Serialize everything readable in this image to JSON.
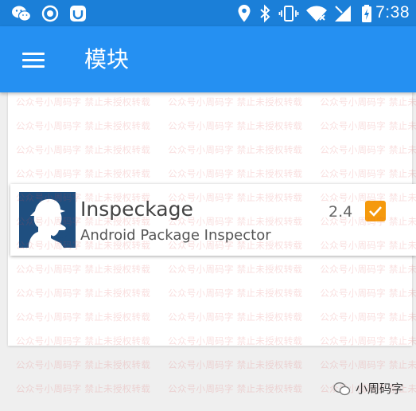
{
  "status_bar": {
    "time": "7:38",
    "icons": [
      "wechat-icon",
      "record-icon",
      "app-icon",
      "location-icon",
      "bluetooth-icon",
      "vibrate-icon",
      "wifi-icon",
      "signal-icon",
      "battery-charging-icon"
    ]
  },
  "app_bar": {
    "title": "模块",
    "menu_icon": "hamburger-menu-icon"
  },
  "modules": [
    {
      "name": "Inspeckage",
      "description": "Android Package Inspector",
      "version": "2.4",
      "enabled": true,
      "icon": "detective-silhouette-icon"
    }
  ],
  "watermark": {
    "text": "公众号小周码字  禁止未授权转载",
    "brand_name": "小周码字"
  },
  "colors": {
    "status_bar": "#1b7fd8",
    "app_bar": "#2590f2",
    "checkbox": "#f59a0c",
    "icon_bg": "#1f4f80"
  }
}
